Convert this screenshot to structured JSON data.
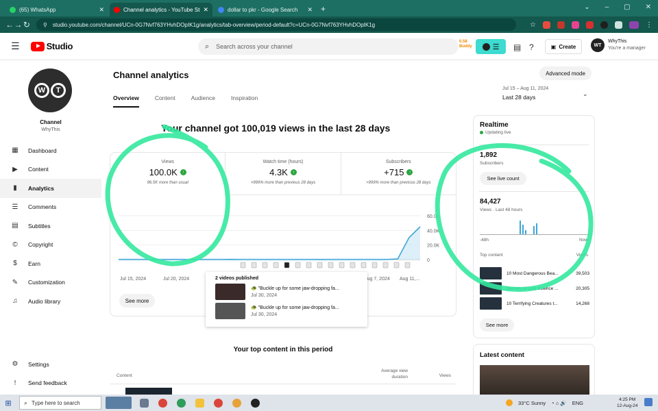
{
  "browser": {
    "tabs": [
      {
        "title": "(65) WhatsApp",
        "color": "#25d366"
      },
      {
        "title": "Channel analytics - YouTube Stu",
        "color": "#ff0000"
      },
      {
        "title": "dollar to pkr - Google Search",
        "color": "#4285f4"
      }
    ],
    "url": "studio.youtube.com/channel/UCn-0G7Nvf763YHvhDOpIK1g/analytics/tab-overview/period-default?c=UCn-0G7Nvf763YHvhDOpIK1g"
  },
  "header": {
    "logo_text": "Studio",
    "search_placeholder": "Search across your channel",
    "ext_badge": "0.58 Buddy",
    "create_label": "Create",
    "account_name": "WhyThis",
    "account_role": "You're a manager",
    "avatar_text": "WT"
  },
  "sidebar": {
    "channel_label": "Channel",
    "channel_name": "WhyThis",
    "items": [
      {
        "label": "Dashboard",
        "icon": "dashboard-icon",
        "glyph": "▦"
      },
      {
        "label": "Content",
        "icon": "content-icon",
        "glyph": "▶"
      },
      {
        "label": "Analytics",
        "icon": "analytics-icon",
        "glyph": "▮"
      },
      {
        "label": "Comments",
        "icon": "comments-icon",
        "glyph": "☰"
      },
      {
        "label": "Subtitles",
        "icon": "subtitles-icon",
        "glyph": "▤"
      },
      {
        "label": "Copyright",
        "icon": "copyright-icon",
        "glyph": "©"
      },
      {
        "label": "Earn",
        "icon": "earn-icon",
        "glyph": "$"
      },
      {
        "label": "Customization",
        "icon": "customization-icon",
        "glyph": "✎"
      },
      {
        "label": "Audio library",
        "icon": "audio-library-icon",
        "glyph": "♫"
      }
    ],
    "bottom_items": [
      {
        "label": "Settings",
        "icon": "settings-icon",
        "glyph": "⚙"
      },
      {
        "label": "Send feedback",
        "icon": "feedback-icon",
        "glyph": "!"
      }
    ]
  },
  "main": {
    "title": "Channel analytics",
    "advanced_label": "Advanced mode",
    "tabs": [
      "Overview",
      "Content",
      "Audience",
      "Inspiration"
    ],
    "period_range": "Jul 15 – Aug 11, 2024",
    "period_label": "Last 28 days",
    "headline": "Your channel got 100,019 views in the last 28 days",
    "metrics": [
      {
        "label": "Views",
        "value": "100.0K",
        "compare": "96.5K more than usual"
      },
      {
        "label": "Watch time (hours)",
        "value": "4.3K",
        "compare": ">999% more than previous 28 days"
      },
      {
        "label": "Subscribers",
        "value": "+715",
        "compare": ">999% more than previous 28 days"
      }
    ],
    "see_more_label": "See more",
    "popup": {
      "heading": "2 videos published",
      "videos": [
        {
          "title": "\"Buckle up for some jaw-dropping fa...",
          "date": "Jul 30, 2024"
        },
        {
          "title": "\"Buckle up for some jaw-dropping fa...",
          "date": "Jul 30, 2024"
        }
      ]
    },
    "top_content_title": "Your top content in this period",
    "table_headers": {
      "content": "Content",
      "avg_duration": "Average view duration",
      "views": "Views"
    }
  },
  "chart_data": {
    "type": "line",
    "x_labels": [
      "Jul 15, 2024",
      "Jul 20, 2024",
      "",
      "",
      "",
      "Aug 7, 2024",
      "Aug 11,..."
    ],
    "y_ticks": [
      "60.0K",
      "40.0K",
      "20.0K",
      "0"
    ],
    "ylim": [
      0,
      60000
    ],
    "values": [
      0,
      0,
      0,
      0,
      0,
      100,
      0,
      0,
      0,
      0,
      200,
      0,
      0,
      0,
      0,
      0,
      0,
      0,
      100,
      0,
      0,
      0,
      0,
      0,
      0,
      1000,
      30000,
      45000
    ],
    "expected_range_upper": 2000,
    "color": "#3ea6d9"
  },
  "realtime": {
    "title": "Realtime",
    "live_label": "Updating live",
    "subscribers": "1,892",
    "subscribers_label": "Subscribers",
    "live_count_label": "See live count",
    "views": "84,427",
    "views_label": "Views · Last 48 hours",
    "axis_left": "-48h",
    "axis_right": "Now",
    "top_content_label": "Top content",
    "top_views_label": "Views",
    "top_items": [
      {
        "title": "10 Most Dangerous Bea...",
        "views": "39,503"
      },
      {
        "title": "Secrets of Lost Science ...",
        "views": "20,305"
      },
      {
        "title": "10 Terrifying Creatures t...",
        "views": "14,268"
      }
    ],
    "see_more_label": "See more"
  },
  "latest": {
    "title": "Latest content"
  },
  "taskbar": {
    "search_placeholder": "Type here to search",
    "weather": "33°C  Sunny",
    "lang": "ENG",
    "time": "4:25 PM",
    "date": "12-Aug-24"
  }
}
